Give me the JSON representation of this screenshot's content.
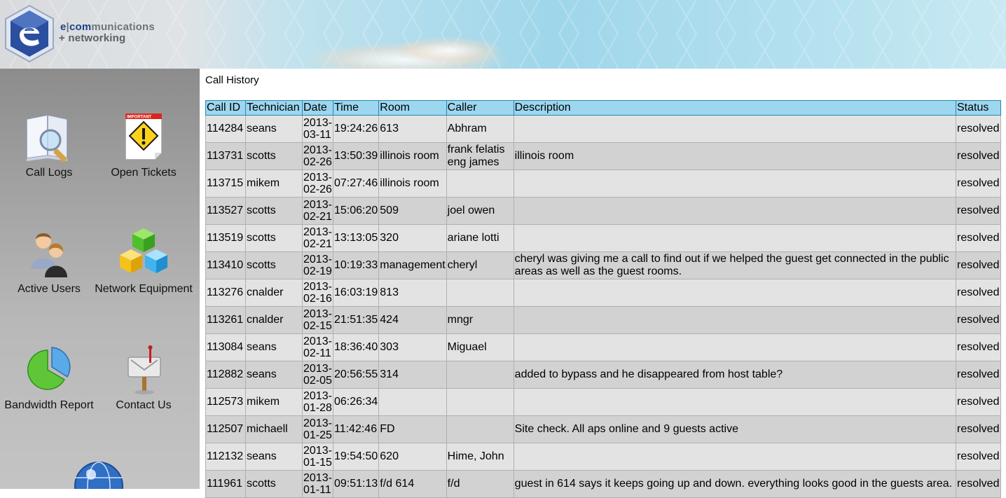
{
  "brand": {
    "line1_e": "e",
    "line1_sep": "|",
    "line1_comm": "com",
    "line1_rest": "munications",
    "line2": "+ networking"
  },
  "sidebar": {
    "items": [
      {
        "label": "Call Logs",
        "icon": "book-magnifier-icon"
      },
      {
        "label": "Open Tickets",
        "icon": "warning-ticket-icon",
        "badge": "IMPORTANT"
      },
      {
        "label": "Active Users",
        "icon": "users-icon"
      },
      {
        "label": "Network Equipment",
        "icon": "cubes-icon"
      },
      {
        "label": "Bandwidth Report",
        "icon": "pie-chart-icon"
      },
      {
        "label": "Contact Us",
        "icon": "mailbox-icon"
      }
    ]
  },
  "page": {
    "title": "Call History"
  },
  "table": {
    "headers": [
      "Call ID",
      "Technician",
      "Date",
      "Time",
      "Room",
      "Caller",
      "Description",
      "Status"
    ],
    "rows": [
      {
        "id": "114284",
        "tech": "seans",
        "date_y": "2013-",
        "date_md": "03-11",
        "time": "19:24:26",
        "room": "613",
        "caller": "Abhram",
        "desc": "",
        "status": "resolved"
      },
      {
        "id": "113731",
        "tech": "scotts",
        "date_y": "2013-",
        "date_md": "02-26",
        "time": "13:50:39",
        "room": "illinois room",
        "caller": "frank felatis eng james",
        "desc": "illinois room",
        "status": "resolved"
      },
      {
        "id": "113715",
        "tech": "mikem",
        "date_y": "2013-",
        "date_md": "02-26",
        "time": "07:27:46",
        "room": "illinois room",
        "caller": "",
        "desc": "",
        "status": "resolved"
      },
      {
        "id": "113527",
        "tech": "scotts",
        "date_y": "2013-",
        "date_md": "02-21",
        "time": "15:06:20",
        "room": "509",
        "caller": "joel owen",
        "desc": "",
        "status": "resolved"
      },
      {
        "id": "113519",
        "tech": "scotts",
        "date_y": "2013-",
        "date_md": "02-21",
        "time": "13:13:05",
        "room": "320",
        "caller": "ariane lotti",
        "desc": "",
        "status": "resolved"
      },
      {
        "id": "113410",
        "tech": "scotts",
        "date_y": "2013-",
        "date_md": "02-19",
        "time": "10:19:33",
        "room": "management",
        "caller": "cheryl",
        "desc": "cheryl was giving me a call to find out if we helped the guest get connected in the public areas as well as the guest rooms.",
        "status": "resolved"
      },
      {
        "id": "113276",
        "tech": "cnalder",
        "date_y": "2013-",
        "date_md": "02-16",
        "time": "16:03:19",
        "room": "813",
        "caller": "",
        "desc": "",
        "status": "resolved"
      },
      {
        "id": "113261",
        "tech": "cnalder",
        "date_y": "2013-",
        "date_md": "02-15",
        "time": "21:51:35",
        "room": "424",
        "caller": "mngr",
        "desc": "",
        "status": "resolved"
      },
      {
        "id": "113084",
        "tech": "seans",
        "date_y": "2013-",
        "date_md": "02-11",
        "time": "18:36:40",
        "room": "303",
        "caller": "Miguael",
        "desc": "",
        "status": "resolved"
      },
      {
        "id": "112882",
        "tech": "seans",
        "date_y": "2013-",
        "date_md": "02-05",
        "time": "20:56:55",
        "room": "314",
        "caller": "",
        "desc": "added to bypass and he disappeared from host table?",
        "status": "resolved"
      },
      {
        "id": "112573",
        "tech": "mikem",
        "date_y": "2013-",
        "date_md": "01-28",
        "time": "06:26:34",
        "room": "",
        "caller": "",
        "desc": "",
        "status": "resolved"
      },
      {
        "id": "112507",
        "tech": "michaell",
        "date_y": "2013-",
        "date_md": "01-25",
        "time": "11:42:46",
        "room": "FD",
        "caller": "",
        "desc": "Site check. All aps online and 9 guests active",
        "status": "resolved"
      },
      {
        "id": "112132",
        "tech": "seans",
        "date_y": "2013-",
        "date_md": "01-15",
        "time": "19:54:50",
        "room": "620",
        "caller": "Hime, John",
        "desc": "",
        "status": "resolved"
      },
      {
        "id": "111961",
        "tech": "scotts",
        "date_y": "2013-",
        "date_md": "01-11",
        "time": "09:51:13",
        "room": "f/d 614",
        "caller": "f/d",
        "desc": "guest in 614 says it keeps going up and down. everything looks good in the guests area.",
        "status": "resolved"
      }
    ]
  },
  "colors": {
    "header_row": "#9dd6ef",
    "row_light": "#e3e3e3",
    "row_dark": "#d2d2d2",
    "brand_blue": "#1f3f8a"
  }
}
